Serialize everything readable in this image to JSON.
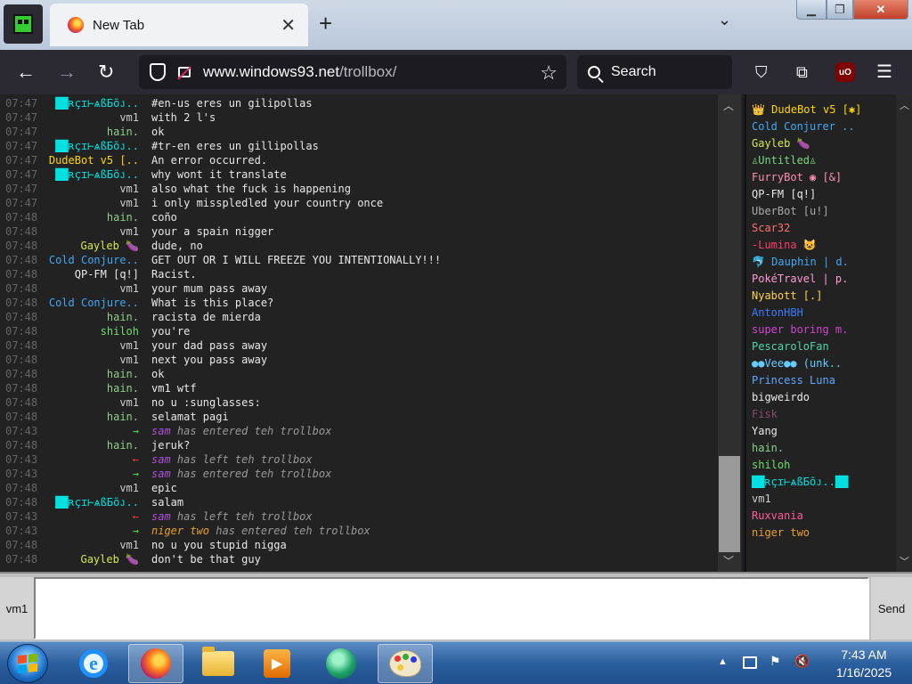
{
  "browser": {
    "tab_title": "New Tab",
    "url_host": "www.windows93.net",
    "url_path": "/trollbox/",
    "search_placeholder": "Search"
  },
  "chat": {
    "messages": [
      {
        "time": "07:47",
        "nick": "██ʀçɪ⊢ѧßБõᴊ..",
        "nick_color": "#00e0e0",
        "text": "#en-us eres un gilipollas"
      },
      {
        "time": "07:47",
        "nick": "vm1",
        "nick_color": "#cccccc",
        "text": "with 2 l's"
      },
      {
        "time": "07:47",
        "nick": "hain.",
        "nick_color": "#8ccf8c",
        "text": "ok"
      },
      {
        "time": "07:47",
        "nick": "██ʀçɪ⊢ѧßБõᴊ..",
        "nick_color": "#00e0e0",
        "text": "#tr-en eres un gillipollas"
      },
      {
        "time": "07:47",
        "nick": "DudeBot v5 [..",
        "nick_color": "#ffd700",
        "text": "An error occurred."
      },
      {
        "time": "07:47",
        "nick": "██ʀçɪ⊢ѧßБõᴊ..",
        "nick_color": "#00e0e0",
        "text": "why wont it translate"
      },
      {
        "time": "07:47",
        "nick": "vm1",
        "nick_color": "#cccccc",
        "text": "also what the fuck is happening"
      },
      {
        "time": "07:47",
        "nick": "vm1",
        "nick_color": "#cccccc",
        "text": "i only misspledled your country once"
      },
      {
        "time": "07:48",
        "nick": "hain.",
        "nick_color": "#8ccf8c",
        "text": "coño"
      },
      {
        "time": "07:48",
        "nick": "vm1",
        "nick_color": "#cccccc",
        "text": "your a spain nigger"
      },
      {
        "time": "07:48",
        "nick": "Gayleb 🍆",
        "nick_color": "#d4e84a",
        "text": "dude, no"
      },
      {
        "time": "07:48",
        "nick": "Cold Conjure..",
        "nick_color": "#3fa9f5",
        "text": "GET OUT OR I WILL FREEZE YOU INTENTIONALLY!!!"
      },
      {
        "time": "07:48",
        "nick": "QP-FM [q!]",
        "nick_color": "#e8e8e8",
        "text": "Racist."
      },
      {
        "time": "07:48",
        "nick": "vm1",
        "nick_color": "#cccccc",
        "text": "your mum pass away"
      },
      {
        "time": "07:48",
        "nick": "Cold Conjure..",
        "nick_color": "#3fa9f5",
        "text": "What is this place?"
      },
      {
        "time": "07:48",
        "nick": "hain.",
        "nick_color": "#8ccf8c",
        "text": "racista de mierda"
      },
      {
        "time": "07:48",
        "nick": "shiloh",
        "nick_color": "#6fdc6f",
        "text": "you're"
      },
      {
        "time": "07:48",
        "nick": "vm1",
        "nick_color": "#cccccc",
        "text": "your dad pass away"
      },
      {
        "time": "07:48",
        "nick": "vm1",
        "nick_color": "#cccccc",
        "text": "next you pass away"
      },
      {
        "time": "07:48",
        "nick": "hain.",
        "nick_color": "#8ccf8c",
        "text": "ok"
      },
      {
        "time": "07:48",
        "nick": "hain.",
        "nick_color": "#8ccf8c",
        "text": "vm1 wtf"
      },
      {
        "time": "07:48",
        "nick": "vm1",
        "nick_color": "#cccccc",
        "text": "no u :sunglasses:"
      },
      {
        "time": "07:48",
        "nick": "hain.",
        "nick_color": "#8ccf8c",
        "text": "selamat pagi"
      },
      {
        "time": "07:43",
        "nick": "→",
        "nick_color": "#4fd64f",
        "sys_user": "sam",
        "sys_color": "#b04fd6",
        "text": " has entered teh trollbox"
      },
      {
        "time": "07:48",
        "nick": "hain.",
        "nick_color": "#8ccf8c",
        "text": "jeruk?"
      },
      {
        "time": "07:43",
        "nick": "←",
        "nick_color": "#e03a3a",
        "sys_user": "sam",
        "sys_color": "#b04fd6",
        "text": " has left teh trollbox"
      },
      {
        "time": "07:43",
        "nick": "→",
        "nick_color": "#4fd64f",
        "sys_user": "sam",
        "sys_color": "#b04fd6",
        "text": " has entered teh trollbox"
      },
      {
        "time": "07:48",
        "nick": "vm1",
        "nick_color": "#cccccc",
        "text": "epic"
      },
      {
        "time": "07:48",
        "nick": "██ʀçɪ⊢ѧßБõᴊ..",
        "nick_color": "#00e0e0",
        "text": "salam"
      },
      {
        "time": "07:43",
        "nick": "←",
        "nick_color": "#e03a3a",
        "sys_user": "sam",
        "sys_color": "#b04fd6",
        "text": " has left teh trollbox"
      },
      {
        "time": "07:43",
        "nick": "→",
        "nick_color": "#4fd64f",
        "sys_user": "niger two",
        "sys_color": "#e8a02a",
        "text": " has entered teh trollbox"
      },
      {
        "time": "07:48",
        "nick": "vm1",
        "nick_color": "#cccccc",
        "text": "no u you stupid nigga"
      },
      {
        "time": "07:48",
        "nick": "Gayleb 🍆",
        "nick_color": "#d4e84a",
        "text": "don't be that guy"
      }
    ]
  },
  "users": [
    {
      "name": "👑 DudeBot v5 [✱]",
      "color": "#ffd700"
    },
    {
      "name": "Cold Conjurer ..",
      "color": "#3fa9f5"
    },
    {
      "name": "Gayleb 🍆",
      "color": "#d4e84a"
    },
    {
      "name": "♙Untitled♙",
      "color": "#7bd67b"
    },
    {
      "name": "FurryBot ◉ [&]",
      "color": "#ff8fb0"
    },
    {
      "name": "QP-FM [q!]",
      "color": "#e8e8e8"
    },
    {
      "name": "UberBot [u!]",
      "color": "#aaaaaa"
    },
    {
      "name": "Scar32",
      "color": "#ff7070"
    },
    {
      "name": "-Lumina 😺",
      "color": "#ff3a6a"
    },
    {
      "name": "🐬 Dauphin | d.",
      "color": "#3fa9f5"
    },
    {
      "name": "PokéTravel | p.",
      "color": "#ff9ad5"
    },
    {
      "name": "Nyabott [.]",
      "color": "#ffd24a"
    },
    {
      "name": "AntonHBH",
      "color": "#3b7bff"
    },
    {
      "name": "super boring m.",
      "color": "#d044d0"
    },
    {
      "name": "PescaroloFan",
      "color": "#4fd6a8"
    },
    {
      "name": "●●Vee●● (unk..",
      "color": "#66ccff"
    },
    {
      "name": "Princess Luna",
      "color": "#5fa8ff"
    },
    {
      "name": "bigweirdo",
      "color": "#e8e8e8"
    },
    {
      "name": "Fisk",
      "color": "#884a6a"
    },
    {
      "name": "Yang",
      "color": "#e8e8e8"
    },
    {
      "name": "hain.",
      "color": "#8ccf8c"
    },
    {
      "name": "shiloh",
      "color": "#6fdc6f"
    },
    {
      "name": "██ʀçɪ⊢ѧßБõᴊ..██",
      "color": "#00e0e0"
    },
    {
      "name": "vm1",
      "color": "#cccccc"
    },
    {
      "name": "Ruxvania",
      "color": "#ff5a9a"
    },
    {
      "name": "niger two",
      "color": "#e8a02a"
    }
  ],
  "input": {
    "nick_label": "vm1",
    "send_label": "Send",
    "message_value": ""
  },
  "taskbar": {
    "time": "7:43 AM",
    "date": "1/16/2025"
  },
  "icons": {
    "back": "arrow-left-icon",
    "forward": "arrow-right-icon",
    "reload": "reload-icon",
    "star": "star-icon",
    "pocket": "pocket-icon",
    "extensions": "puzzle-icon",
    "ublock": "ublock-icon",
    "menu": "hamburger-icon"
  }
}
